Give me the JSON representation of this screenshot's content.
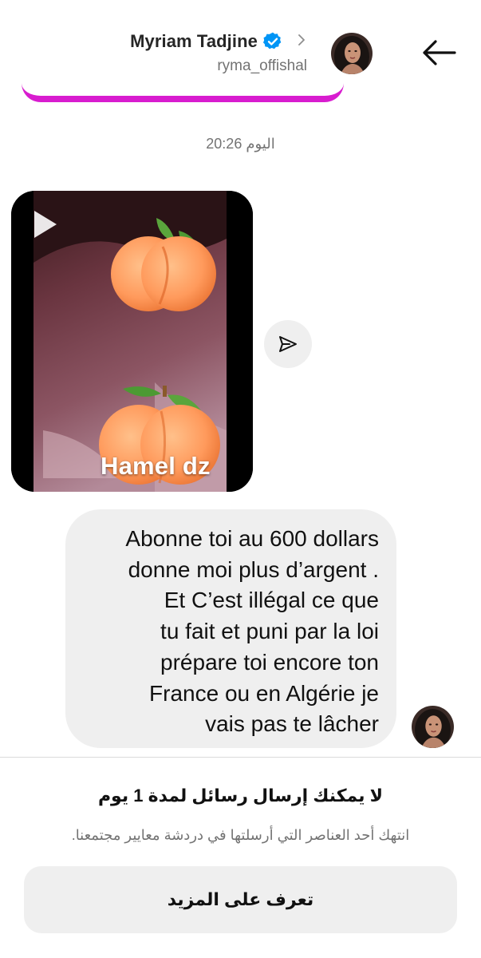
{
  "header": {
    "display_name": "Myriam Tadjine",
    "username": "ryma_offishal",
    "verified": true,
    "icons": [
      "back-arrow-icon",
      "verified-badge-icon",
      "chevron-right-icon"
    ],
    "accent_color": "#d81ccf"
  },
  "conversation": {
    "timestamp": "اليوم 20:26",
    "video_message": {
      "caption": "Hamel dz",
      "icons": [
        "play-icon",
        "peach-emoji"
      ]
    },
    "share_icon": "send-arrow-icon",
    "text_message": "Abonne toi au 600 dollars\ndonne moi plus d’argent .\nEt C’est illégal ce que\ntu fait et puni par la loi\nprépare toi encore ton\nFrance ou en Algérie je\nvais pas te lâcher"
  },
  "restriction": {
    "title": "لا يمكنك إرسال رسائل لمدة 1 يوم",
    "text": "انتهك أحد العناصر التي أرسلتها في دردشة معايير مجتمعنا.",
    "button_label": "تعرف على المزيد"
  }
}
